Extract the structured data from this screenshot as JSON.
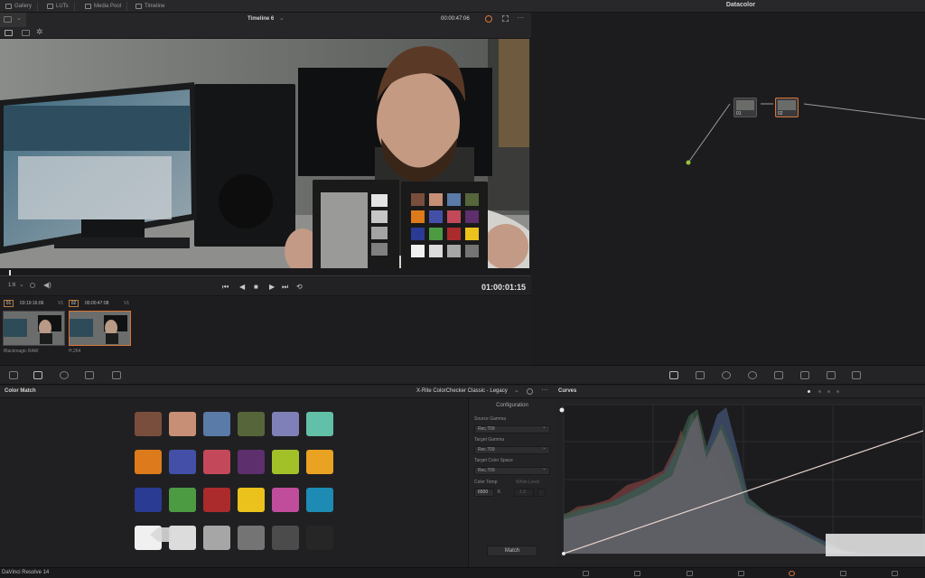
{
  "top_tabs": [
    "Gallery",
    "LUTs",
    "Media Pool",
    "Timeline"
  ],
  "node_editor_title": "Datacolor",
  "viewer": {
    "timeline_name": "Timeline 6",
    "source_timecode": "00:00:47:06",
    "zoom": "1:6",
    "record_timecode": "01:00:01:15"
  },
  "clips": [
    {
      "number": "01",
      "timecode": "03:19:16:06",
      "track": "V1",
      "codec": "Blackmagic RAW"
    },
    {
      "number": "02",
      "timecode": "00:00:47:08",
      "track": "V1",
      "codec": "H.264"
    }
  ],
  "nodes": [
    {
      "label": "01"
    },
    {
      "label": "02"
    }
  ],
  "color_match": {
    "title": "Color Match",
    "chart_type": "X-Rite ColorChecker Classic - Legacy",
    "patches": [
      [
        "#7a4e3c",
        "#c79076",
        "#5a7aa8",
        "#56653a",
        "#8080b9",
        "#62bfa8"
      ],
      [
        "#dd7a1b",
        "#4450a8",
        "#c3495a",
        "#5d2f6c",
        "#a2c128",
        "#e9a222"
      ],
      [
        "#2a3b94",
        "#4c9a42",
        "#ab2a2c",
        "#ebc11b",
        "#c04d9b",
        "#1e8bb4"
      ],
      [
        "#f0f0f0",
        "#dcdcdc",
        "#a6a6a6",
        "#747474",
        "#4b4b4b",
        "#262626"
      ]
    ]
  },
  "config": {
    "title": "Configuration",
    "source_gamma_label": "Source Gamma",
    "source_gamma": "Rec.709",
    "target_gamma_label": "Target Gamma",
    "target_gamma": "Rec.709",
    "target_color_space_label": "Target Color Space",
    "target_color_space": "Rec.709",
    "color_temp_label": "Color Temp",
    "white_level_label": "White Level",
    "color_temp": "6500",
    "color_temp_unit": "K",
    "white_level": "1.0",
    "match_button": "Match"
  },
  "curves": {
    "title": "Curves"
  },
  "status": {
    "app_name": "DaVinci Resolve 14"
  },
  "colors": {
    "accent_orange": "#d8743a",
    "curve_line": "#e8d5d0",
    "node_green": "#9ac43b"
  }
}
